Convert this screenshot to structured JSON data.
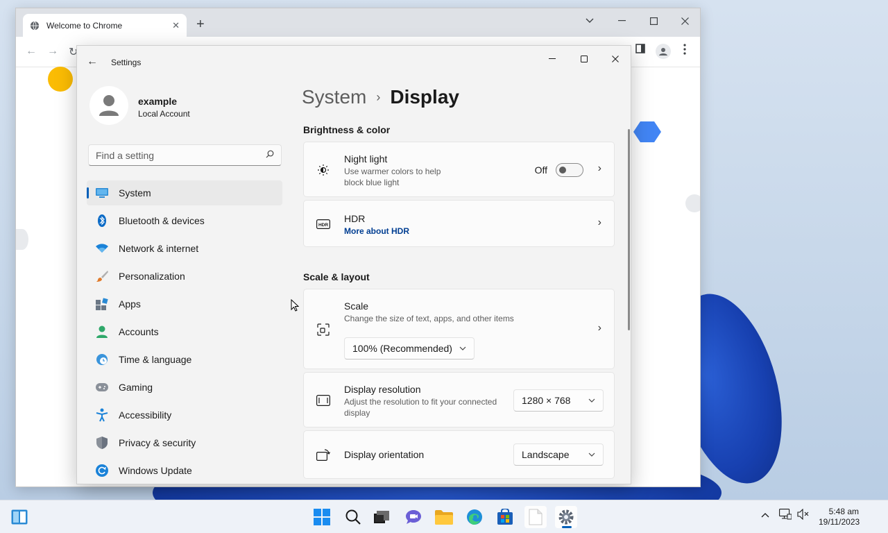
{
  "chrome": {
    "tab_title": "Welcome to Chrome",
    "tab_close": "✕",
    "new_tab": "+"
  },
  "settings_window": {
    "title": "Settings",
    "profile": {
      "name": "example",
      "account_type": "Local Account"
    },
    "search": {
      "placeholder": "Find a setting"
    },
    "nav": [
      {
        "label": "System",
        "icon": "system-icon",
        "active": true
      },
      {
        "label": "Bluetooth & devices",
        "icon": "bluetooth-icon"
      },
      {
        "label": "Network & internet",
        "icon": "wifi-icon"
      },
      {
        "label": "Personalization",
        "icon": "brush-icon"
      },
      {
        "label": "Apps",
        "icon": "apps-icon"
      },
      {
        "label": "Accounts",
        "icon": "accounts-icon"
      },
      {
        "label": "Time & language",
        "icon": "globe-clock-icon"
      },
      {
        "label": "Gaming",
        "icon": "gamepad-icon"
      },
      {
        "label": "Accessibility",
        "icon": "accessibility-icon"
      },
      {
        "label": "Privacy & security",
        "icon": "shield-icon"
      },
      {
        "label": "Windows Update",
        "icon": "update-icon"
      }
    ],
    "breadcrumb": {
      "parent": "System",
      "current": "Display"
    },
    "sections": {
      "brightness": {
        "heading": "Brightness & color",
        "night_light": {
          "title": "Night light",
          "desc": "Use warmer colors to help block blue light",
          "state": "Off"
        },
        "hdr": {
          "title": "HDR",
          "link": "More about HDR"
        }
      },
      "scale_layout": {
        "heading": "Scale & layout",
        "scale": {
          "title": "Scale",
          "desc": "Change the size of text, apps, and other items",
          "value": "100% (Recommended)"
        },
        "resolution": {
          "title": "Display resolution",
          "desc": "Adjust the resolution to fit your connected display",
          "value": "1280 × 768"
        },
        "orientation": {
          "title": "Display orientation",
          "value": "Landscape"
        }
      }
    }
  },
  "taskbar": {
    "clock_time": "5:48 am",
    "clock_date": "19/11/2023",
    "apps": [
      "start-icon",
      "search-icon",
      "task-view-icon",
      "teams-chat-icon",
      "file-explorer-icon",
      "edge-icon",
      "store-icon",
      "notepad-icon",
      "settings-icon"
    ]
  },
  "colors": {
    "accent": "#005fb8",
    "link": "#003e92"
  }
}
